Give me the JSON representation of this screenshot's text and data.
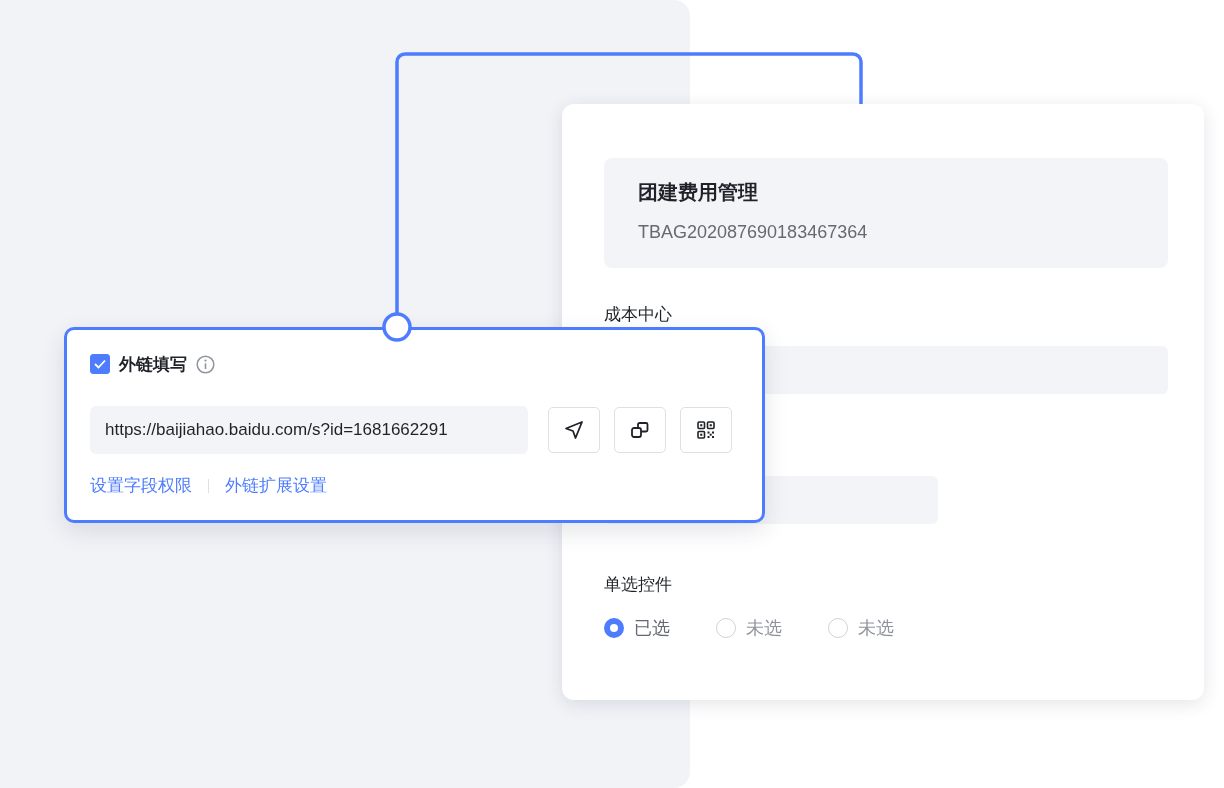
{
  "form_card": {
    "header": {
      "title": "团建费用管理",
      "code": "TBAG202087690183467364"
    },
    "fields": [
      {
        "label": "成本中心"
      },
      {
        "kind": "short"
      }
    ],
    "radio_group": {
      "label": "单选控件",
      "options": [
        {
          "label": "已选",
          "selected": true
        },
        {
          "label": "未选",
          "selected": false
        },
        {
          "label": "未选",
          "selected": false
        }
      ]
    }
  },
  "link_popup": {
    "checkbox": {
      "label": "外链填写",
      "checked": true
    },
    "url_field": {
      "value": "https://baijiahao.baidu.com/s?id=1681662291"
    },
    "buttons": [
      {
        "kind": "send"
      },
      {
        "kind": "copy"
      },
      {
        "kind": "qrcode"
      }
    ],
    "links": [
      "设置字段权限",
      "外链扩展设置"
    ]
  }
}
